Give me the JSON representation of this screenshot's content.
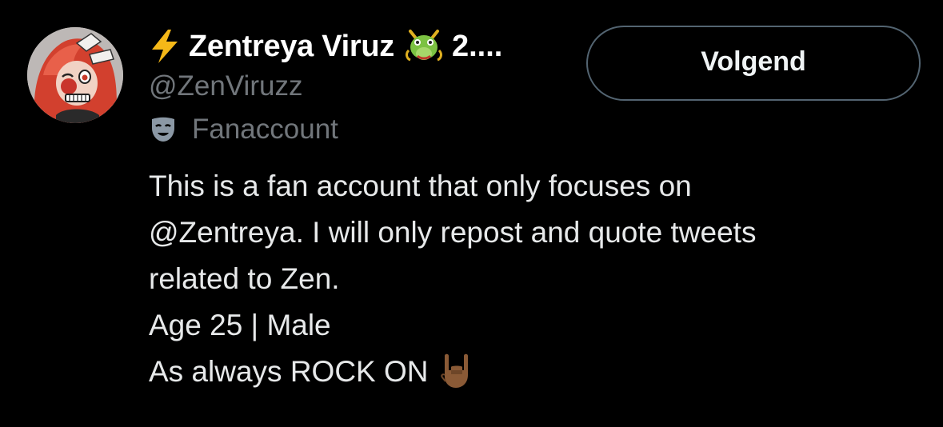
{
  "profile": {
    "display_name": "Zentreya Viruz",
    "name_suffix": "2....",
    "handle": "@ZenViruzz",
    "category": "Fanaccount",
    "follow_button_label": "Volgend",
    "bio": {
      "line1": "This is a fan account that only focuses on",
      "line2_mention": "@Zentreya",
      "line2_rest": ". I will only repost and quote tweets",
      "line3": "related to Zen.",
      "line4": "Age 25 | Male",
      "line5": "As always ROCK ON"
    }
  },
  "icons": {
    "bolt": "high-voltage-emoji",
    "dragon": "dragon-face-emoji",
    "category": "performing-arts-mask-icon",
    "rock_on": "sign-of-the-horns-emoji"
  },
  "colors": {
    "background": "#000000",
    "primary_text": "#e7e9ea",
    "secondary_text": "#71767b",
    "button_border": "#536471",
    "bolt_yellow": "#f5b818",
    "dragon_green": "#7cc242"
  }
}
